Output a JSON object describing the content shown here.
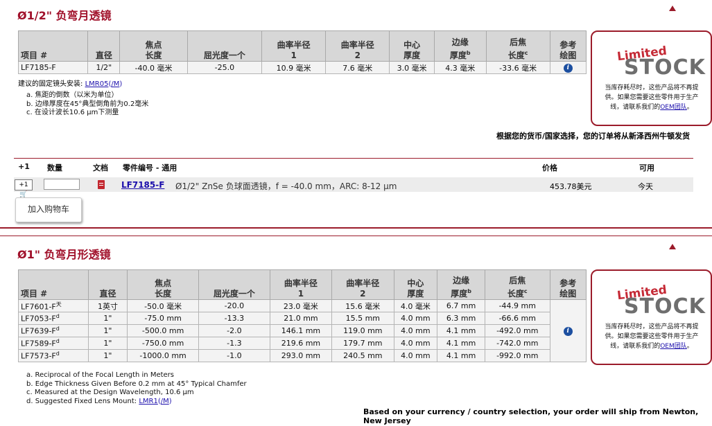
{
  "section1": {
    "title": "Ø1/2\" 负弯月透镜",
    "headers": {
      "item": "项目 #",
      "diameter": "直径",
      "focal_1": "焦点",
      "focal_2": "长度",
      "diopter": "屈光度一个",
      "r1_1": "曲率半径",
      "r1_2": "1",
      "r2_1": "曲率半径",
      "r2_2": "2",
      "ct_1": "中心",
      "ct_2": "厚度",
      "et_1": "边缘",
      "et_2": "厚度",
      "et_sup": "b",
      "bfl_1": "后焦",
      "bfl_2": "长度",
      "bfl_sup": "c",
      "ref_1": "参考",
      "ref_2": "绘图"
    },
    "row": {
      "item": "LF7185-F",
      "diameter": "1/2\"",
      "focal": "-40.0 毫米",
      "diopter": "-25.0",
      "r1": "10.9 毫米",
      "r2": "7.6 毫米",
      "ct": "3.0 毫米",
      "et": "4.3 毫米",
      "bfl": "-33.6 毫米"
    },
    "mount_label": "建议的固定镜头安装:",
    "mount_link": "LMR05",
    "mount_link2": "/M",
    "notes": [
      "a. 焦距的倒数（以米为单位）",
      "b. 边缘厚度在45°典型倒角前为0.2毫米",
      "c. 在设计波长10.6 µm下测量"
    ],
    "ship_text": "根据您的货币/国家选择，您的订单将从新泽西州牛顿发货",
    "stock_box": {
      "limited": "Limited",
      "stock": "STOCK",
      "text_1": "当库存耗尽时，这些产品将不再提",
      "text_2": "供。如果您需要这些零件用于生产",
      "text_3": "线，请联系我们的",
      "link": "OEM团队",
      "text_end": "。"
    }
  },
  "order": {
    "col_plus": "+1",
    "col_qty": "数量",
    "col_doc": "文档",
    "col_part": "零件编号 - 通用",
    "col_price": "价格",
    "col_avail": "可用",
    "cart_icon_label": "+1",
    "part_number": "LF7185-F",
    "description": "Ø1/2\" ZnSe 负球面透镜，f = -40.0 mm，ARC: 8-12 µm",
    "price": "453.78美元",
    "availability": "今天",
    "qty_value": "",
    "add_to_cart": "加入购物车"
  },
  "section2": {
    "title": "Ø1\" 负弯月形透镜",
    "headers": {
      "item": "项目 #",
      "diameter": "直径",
      "focal_1": "焦点",
      "focal_2": "长度",
      "diopter": "屈光度一个",
      "r1_1": "曲率半径",
      "r1_2": "1",
      "r2_1": "曲率半径",
      "r2_2": "2",
      "ct_1": "中心",
      "ct_2": "厚度",
      "et_1": "边缘",
      "et_2": "厚度",
      "et_sup": "b",
      "bfl_1": "后焦",
      "bfl_2": "长度",
      "bfl_sup": "c",
      "ref_1": "参考",
      "ref_2": "绘图"
    },
    "rows": [
      {
        "item": "LF7601-F",
        "sup": "天",
        "diameter": "1英寸",
        "focal": "-50.0 毫米",
        "diopter": "-20.0",
        "r1": "23.0 毫米",
        "r2": "15.6 毫米",
        "ct": "4.0 毫米",
        "et": "6.7 mm",
        "bfl": "-44.9 mm"
      },
      {
        "item": "LF7053-F",
        "sup": "d",
        "diameter": "1\"",
        "focal": "-75.0 mm",
        "diopter": "-13.3",
        "r1": "21.0 mm",
        "r2": "15.5 mm",
        "ct": "4.0 mm",
        "et": "6.3 mm",
        "bfl": "-66.6 mm"
      },
      {
        "item": "LF7639-F",
        "sup": "d",
        "diameter": "1\"",
        "focal": "-500.0 mm",
        "diopter": "-2.0",
        "r1": "146.1 mm",
        "r2": "119.0 mm",
        "ct": "4.0 mm",
        "et": "4.1 mm",
        "bfl": "-492.0 mm"
      },
      {
        "item": "LF7589-F",
        "sup": "d",
        "diameter": "1\"",
        "focal": "-750.0 mm",
        "diopter": "-1.3",
        "r1": "219.6 mm",
        "r2": "179.7 mm",
        "ct": "4.0 mm",
        "et": "4.1 mm",
        "bfl": "-742.0 mm"
      },
      {
        "item": "LF7573-F",
        "sup": "d",
        "diameter": "1\"",
        "focal": "-1000.0 mm",
        "diopter": "-1.0",
        "r1": "293.0 mm",
        "r2": "240.5 mm",
        "ct": "4.0 mm",
        "et": "4.1 mm",
        "bfl": "-992.0 mm"
      }
    ],
    "notes": [
      "a. Reciprocal of the Focal Length in Meters",
      "b. Edge Thickness Given Before 0.2 mm at 45° Typical Chamfer",
      "c. Measured at the Design Wavelength, 10.6 µm"
    ],
    "note_d": "d. Suggested Fixed Lens Mount:",
    "note_d_link": "LMR1",
    "note_d_link2": "/M",
    "ship_text": "Based on your currency / country selection, your order will ship from Newton, New Jersey",
    "stock_box": {
      "limited": "Limited",
      "stock": "STOCK",
      "text_1": "当库存耗尽时，这些产品将不再提",
      "text_2": "供。如果您需要这些零件用于生产",
      "text_3": "线，请联系我们的",
      "link": "OEM团队",
      "text_end": "。"
    }
  },
  "colors": {
    "accent": "#9b1b2a",
    "title": "#a0102a",
    "header_bg": "#d7d7d7",
    "link": "#1a0dab",
    "info": "#1c4fa0"
  },
  "icons": [
    "up-arrow-icon",
    "info-icon",
    "cart-icon",
    "document-icon"
  ]
}
